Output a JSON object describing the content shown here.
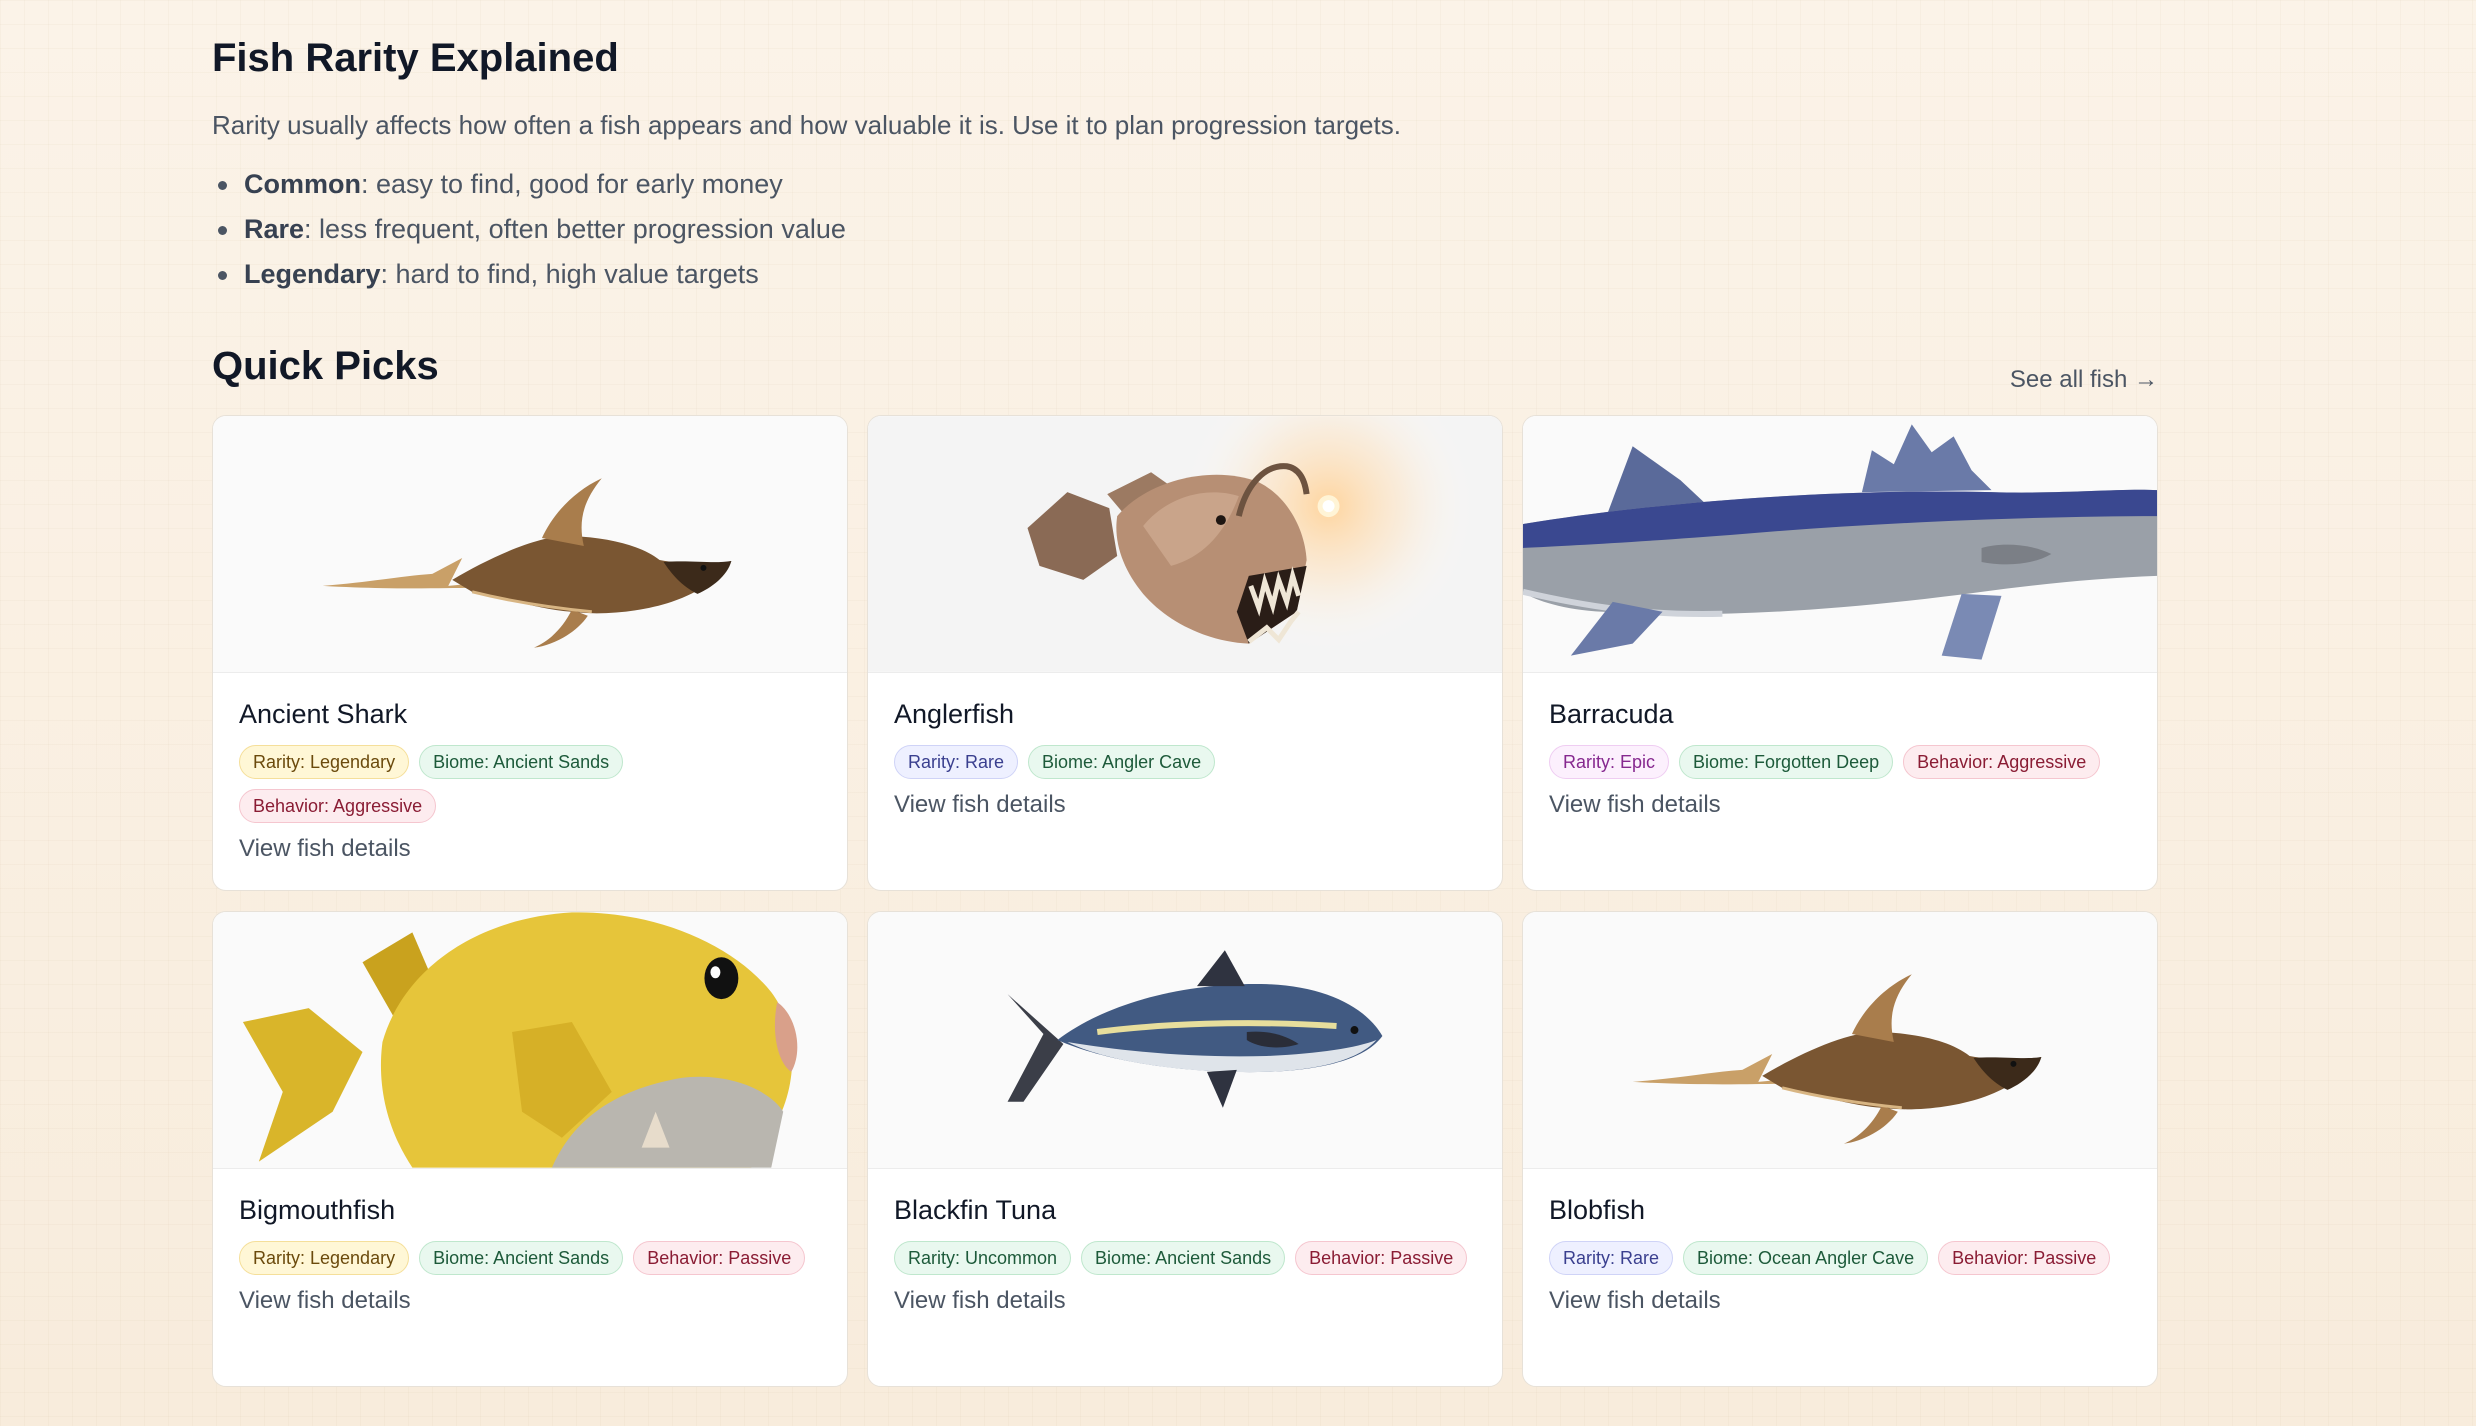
{
  "rarity": {
    "title": "Fish Rarity Explained",
    "intro": "Rarity usually affects how often a fish appears and how valuable it is. Use it to plan progression targets.",
    "items": [
      {
        "term": "Common",
        "desc": ": easy to find, good for early money"
      },
      {
        "term": "Rare",
        "desc": ": less frequent, often better progression value"
      },
      {
        "term": "Legendary",
        "desc": ": hard to find, high value targets"
      }
    ]
  },
  "quick_picks": {
    "title": "Quick Picks",
    "see_all": "See all fish →",
    "cards": [
      {
        "name": "Ancient Shark",
        "rarity": "Rarity: Legendary",
        "biome": "Biome: Ancient Sands",
        "behavior": "Behavior: Aggressive",
        "link": "View fish details",
        "image_icon": "ancient-shark-fish-icon"
      },
      {
        "name": "Anglerfish",
        "rarity": "Rarity: Rare",
        "biome": "Biome: Angler Cave",
        "link": "View fish details",
        "image_icon": "anglerfish-icon"
      },
      {
        "name": "Barracuda",
        "rarity": "Rarity: Epic",
        "biome": "Biome: Forgotten Deep",
        "behavior": "Behavior: Aggressive",
        "link": "View fish details",
        "image_icon": "barracuda-icon"
      },
      {
        "name": "Bigmouthfish",
        "rarity": "Rarity: Legendary",
        "biome": "Biome: Ancient Sands",
        "behavior": "Behavior: Passive",
        "link": "View fish details",
        "image_icon": "bigmouthfish-icon"
      },
      {
        "name": "Blackfin Tuna",
        "rarity": "Rarity: Uncommon",
        "biome": "Biome: Ancient Sands",
        "behavior": "Behavior: Passive",
        "link": "View fish details",
        "image_icon": "blackfin-tuna-icon"
      },
      {
        "name": "Blobfish",
        "rarity": "Rarity: Rare",
        "biome": "Biome: Ocean Angler Cave",
        "behavior": "Behavior: Passive",
        "link": "View fish details",
        "image_icon": "blobfish-icon"
      }
    ]
  },
  "colors": {
    "background": "#f8efe1",
    "legendary_tag": "#fff7d6",
    "rare_tag": "#eef0ff",
    "epic_tag": "#fcf0fd",
    "uncommon_tag": "#e9f8ef",
    "biome_tag": "#e9f8ef",
    "behavior_tag": "#fdecef"
  }
}
